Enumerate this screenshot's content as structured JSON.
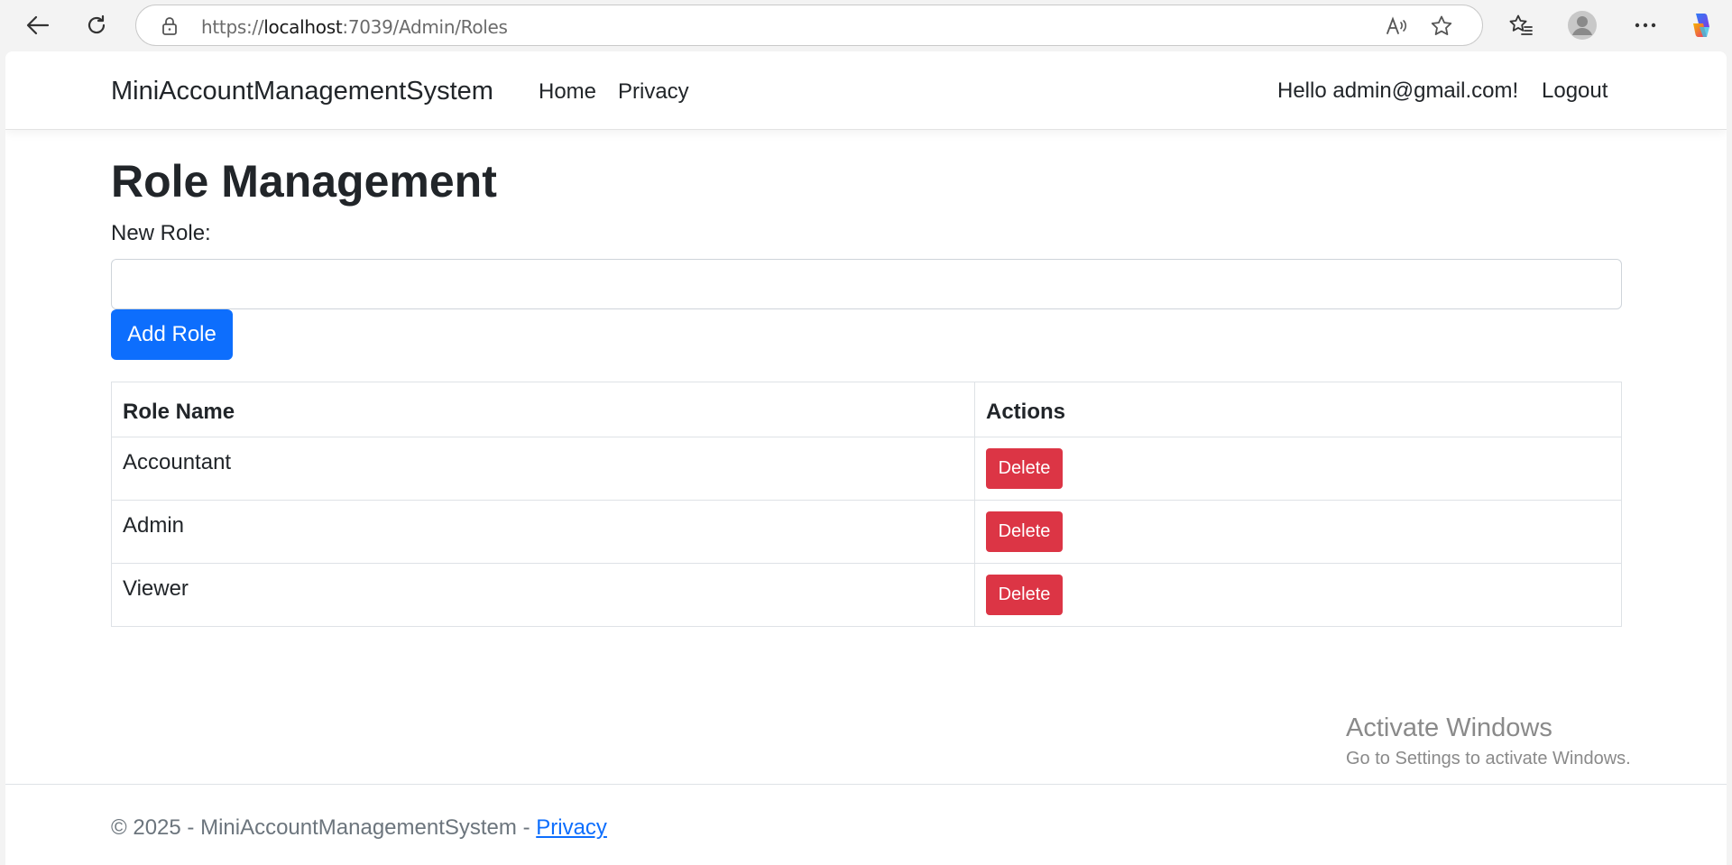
{
  "browser": {
    "url_scheme": "https://",
    "url_host": "localhost",
    "url_path": ":7039/Admin/Roles"
  },
  "navbar": {
    "brand": "MiniAccountManagementSystem",
    "links": [
      "Home",
      "Privacy"
    ],
    "greeting": "Hello admin@gmail.com!",
    "logout_label": "Logout"
  },
  "main": {
    "title": "Role Management",
    "new_role_label": "New Role:",
    "new_role_value": "",
    "add_button_label": "Add Role",
    "table": {
      "headers": [
        "Role Name",
        "Actions"
      ],
      "rows": [
        {
          "name": "Accountant",
          "action": "Delete"
        },
        {
          "name": "Admin",
          "action": "Delete"
        },
        {
          "name": "Viewer",
          "action": "Delete"
        }
      ]
    }
  },
  "footer": {
    "text": "© 2025 - MiniAccountManagementSystem - ",
    "privacy_link": "Privacy"
  },
  "watermark": {
    "title": "Activate Windows",
    "subtitle": "Go to Settings to activate Windows."
  },
  "colors": {
    "primary": "#0d6efd",
    "danger": "#dc3545",
    "text": "#212529",
    "muted": "#6c757d"
  },
  "icons": [
    "back-arrow-icon",
    "refresh-icon",
    "lock-icon",
    "read-aloud-icon",
    "favorite-star-icon",
    "favorites-list-icon",
    "profile-avatar-icon",
    "more-menu-icon",
    "copilot-icon"
  ]
}
